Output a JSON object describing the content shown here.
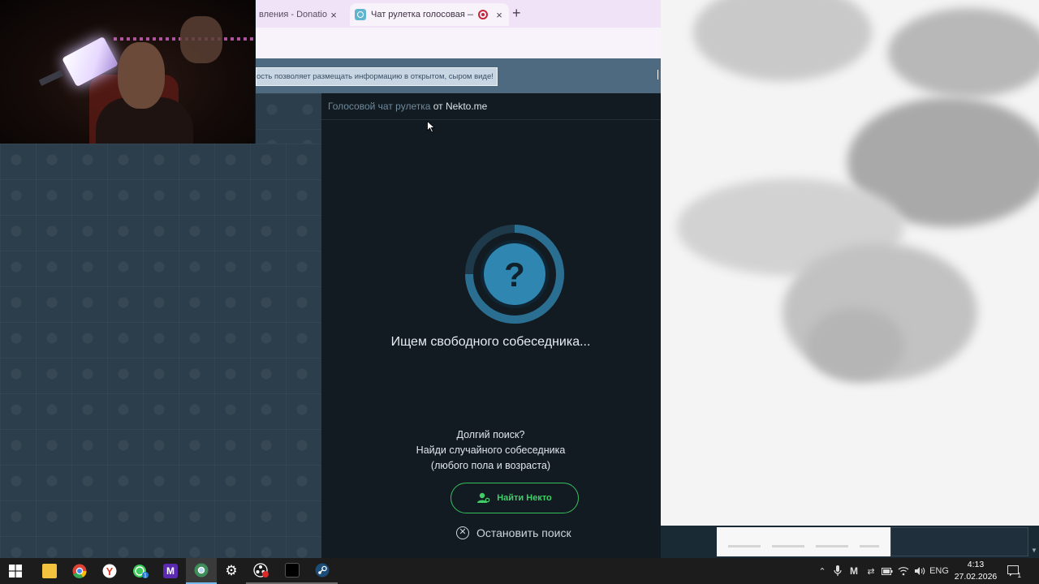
{
  "browser": {
    "tabs": [
      {
        "title": "вления - Donatio",
        "active": false
      },
      {
        "title": "Чат рулетка голосовая — ",
        "active": true,
        "recording": true
      }
    ],
    "close_glyph": "×",
    "new_tab_glyph": "+"
  },
  "banner": {
    "note": "ость позволяет размещать информацию в открытом, сыром виде!"
  },
  "chat": {
    "header_link": "Голосовой чат рулетка",
    "header_from": " от Nekto.me",
    "spinner_symbol": "?",
    "status": "Ищем свободного собеседника...",
    "long_search_lines": [
      "Долгий поиск?",
      "Найди случайного собеседника",
      "(любого пола и возраста)"
    ],
    "find_button": "Найти Некто",
    "stop_button": "Остановить поиск",
    "accent_color": "#3fcf66",
    "spinner_color": "#2f86b0"
  },
  "taskbar": {
    "apps": [
      {
        "name": "start",
        "icon": "windows-icon"
      },
      {
        "name": "explorer",
        "icon": "folder-icon"
      },
      {
        "name": "chrome",
        "icon": "chrome-icon"
      },
      {
        "name": "yandex",
        "icon": "yandex-icon"
      },
      {
        "name": "whatsapp",
        "icon": "whatsapp-icon",
        "badge": "1"
      },
      {
        "name": "mirotalk",
        "icon": "m-app-icon"
      },
      {
        "name": "chrome-active",
        "icon": "chrome-icon"
      },
      {
        "name": "settings",
        "icon": "gear-icon"
      },
      {
        "name": "obs",
        "icon": "obs-icon"
      },
      {
        "name": "capcut",
        "icon": "video-editor-icon"
      },
      {
        "name": "steam",
        "icon": "steam-icon"
      }
    ],
    "language": "ENG",
    "time": "4:13",
    "date": "27.02.2026",
    "notification_count": "1"
  }
}
